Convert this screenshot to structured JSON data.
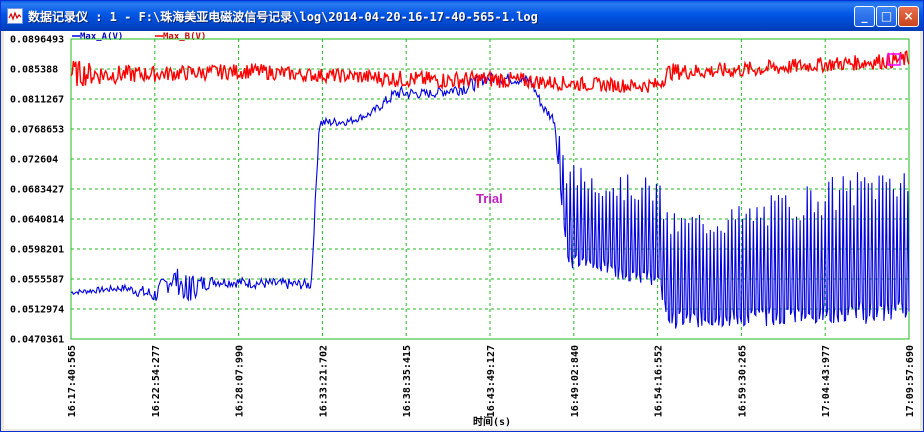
{
  "window": {
    "title": "数据记录仪 : 1 - F:\\珠海美亚电磁波信号记录\\log\\2014-04-20-16-17-40-565-1.log",
    "minimize_label": "_",
    "maximize_label": "□",
    "close_label": "×"
  },
  "watermark": "Trial",
  "colors": {
    "grid": "#22bb22",
    "series_a": "#0000e0",
    "series_b": "#ff0000",
    "marker": "#ff00ff"
  },
  "chart_data": {
    "type": "line",
    "title": "",
    "xlabel": "时间(s)",
    "ylabel": "",
    "ylim": [
      0.0470361,
      0.0896493
    ],
    "xlim": [
      "16:17:40:565",
      "17:09:57:690"
    ],
    "grid": true,
    "legend_position": "top-left",
    "y_ticks": [
      "0.0896493",
      "0.085388",
      "0.0811267",
      "0.0768653",
      "0.072604",
      "0.0683427",
      "0.0640814",
      "0.0598201",
      "0.0555587",
      "0.0512974",
      "0.0470361"
    ],
    "x_ticks": [
      "16:17:40:565",
      "16:22:54:277",
      "16:28:07:990",
      "16:33:21:702",
      "16:38:35:415",
      "16:43:49:127",
      "16:49:02:840",
      "16:54:16:552",
      "16:59:30:265",
      "17:04:43:977",
      "17:09:57:690"
    ],
    "series": [
      {
        "name": "Max_A(V)",
        "color": "#0000e0",
        "x": [
          "16:17:40:565",
          "16:21:00",
          "16:22:54:277",
          "16:24:00",
          "16:25:00",
          "16:26:30",
          "16:30:00",
          "16:32:40",
          "16:33:10",
          "16:35:00",
          "16:36:20",
          "16:38:00",
          "16:40:00",
          "16:42:30",
          "16:43:30",
          "16:45:00",
          "16:46:20",
          "16:47:10",
          "16:47:50",
          "16:48:40",
          "16:50:00",
          "16:52:00",
          "16:54:16:552",
          "16:55:00",
          "17:00:00",
          "17:04:00",
          "17:09:57:690"
        ],
        "min": [
          0.0533,
          0.0538,
          0.052,
          0.054,
          0.0522,
          0.0545,
          0.0541,
          0.054,
          0.077,
          0.0774,
          0.0785,
          0.081,
          0.0812,
          0.0818,
          0.0832,
          0.0832,
          0.083,
          0.079,
          0.0775,
          0.057,
          0.0565,
          0.0555,
          0.0545,
          0.0485,
          0.0488,
          0.049,
          0.0492
        ],
        "max": [
          0.054,
          0.0548,
          0.0545,
          0.0575,
          0.0565,
          0.056,
          0.0557,
          0.0555,
          0.0785,
          0.0785,
          0.0795,
          0.083,
          0.0825,
          0.084,
          0.085,
          0.0848,
          0.0845,
          0.0805,
          0.079,
          0.072,
          0.0715,
          0.0705,
          0.07,
          0.065,
          0.0665,
          0.0695,
          0.073
        ]
      },
      {
        "name": "Max_B(V)",
        "color": "#ff0000",
        "x": [
          "16:17:40:565",
          "16:20:00",
          "16:23:00",
          "16:26:00",
          "16:29:00",
          "16:32:00",
          "16:35:00",
          "16:38:00",
          "16:41:00",
          "16:44:00",
          "16:47:00",
          "16:50:00",
          "16:53:00",
          "16:54:16:552",
          "16:55:00",
          "16:58:00",
          "17:01:00",
          "17:04:00",
          "17:07:00",
          "17:09:57:690"
        ],
        "min": [
          0.0828,
          0.0832,
          0.0836,
          0.0838,
          0.084,
          0.0836,
          0.0834,
          0.0828,
          0.0826,
          0.0827,
          0.0825,
          0.0822,
          0.082,
          0.082,
          0.0838,
          0.084,
          0.0843,
          0.0849,
          0.0852,
          0.0856
        ],
        "max": [
          0.0868,
          0.086,
          0.0858,
          0.086,
          0.0862,
          0.0856,
          0.0854,
          0.0852,
          0.085,
          0.0852,
          0.0846,
          0.0842,
          0.084,
          0.0842,
          0.0862,
          0.0862,
          0.0866,
          0.087,
          0.0874,
          0.088
        ]
      }
    ]
  }
}
